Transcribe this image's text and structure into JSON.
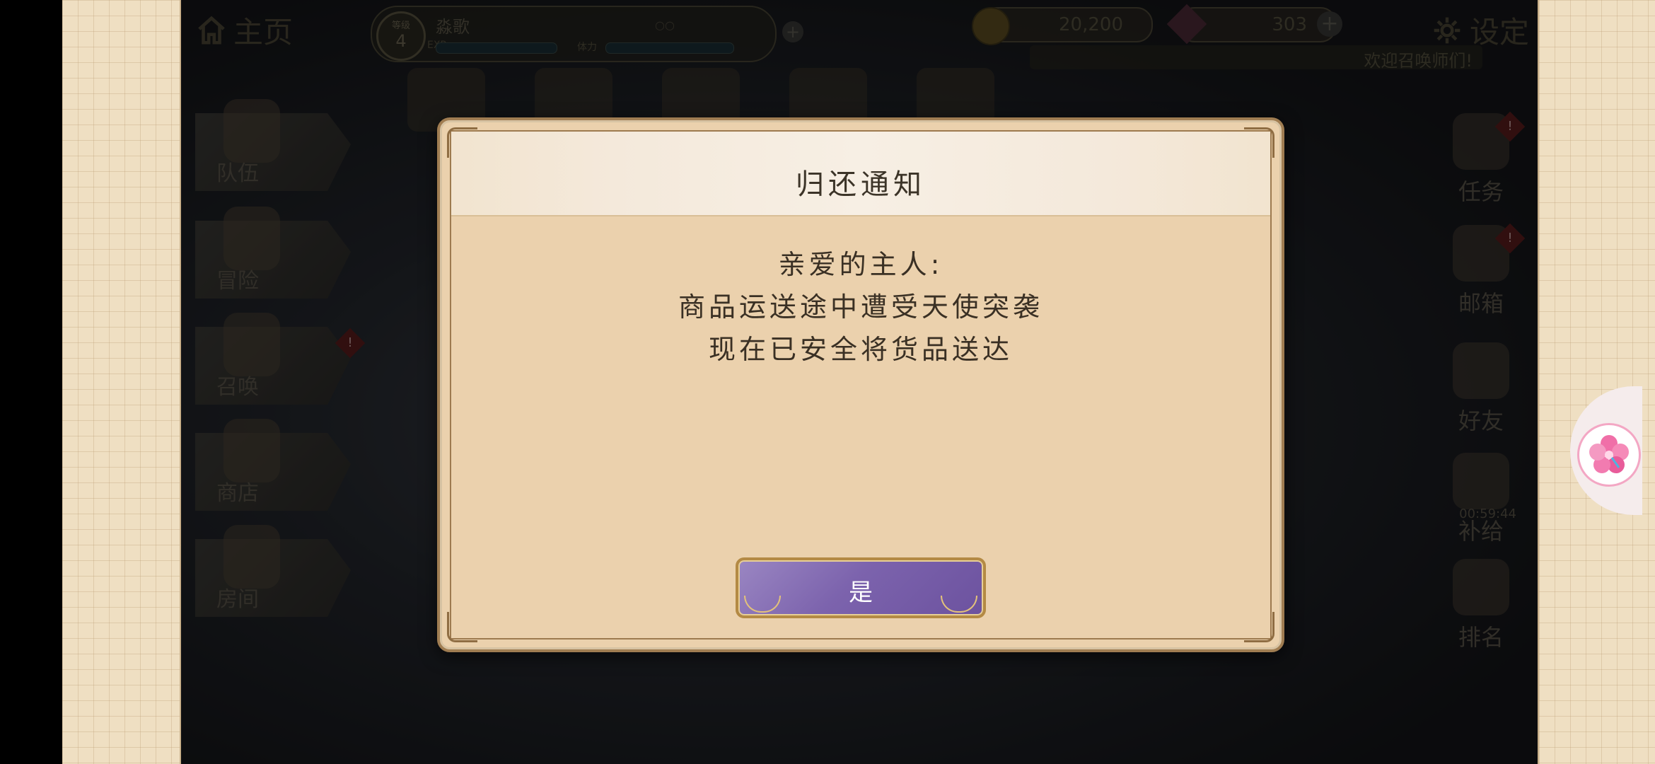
{
  "top_bar": {
    "home_label": "主页",
    "settings_label": "设定",
    "player": {
      "level_label": "等级",
      "level": "4",
      "name": "淼歌",
      "exp_label": "EXP",
      "stamina_label": "体力"
    },
    "gold": "20,200",
    "gems": "303",
    "marquee_text": "欢迎召唤师们!"
  },
  "left_menu": [
    {
      "label": "队伍"
    },
    {
      "label": "冒险"
    },
    {
      "label": "召唤",
      "badge": "!"
    },
    {
      "label": "商店"
    },
    {
      "label": "房间"
    }
  ],
  "right_menu": [
    {
      "label": "任务",
      "badge": "!"
    },
    {
      "label": "邮箱",
      "badge": "!"
    },
    {
      "label": "好友"
    },
    {
      "label": "补给"
    },
    {
      "label": "排名"
    }
  ],
  "timer": "00:59:44",
  "dialog": {
    "title": "归还通知",
    "message_lines": [
      "亲爱的主人:",
      "商品运送途中遭受天使突袭",
      "现在已安全将货品送达"
    ],
    "confirm_label": "是"
  },
  "colors": {
    "dialog_bg": "#ebd1ad",
    "button_purple": "#7c63ad",
    "side_pattern": "#efdfc2"
  }
}
